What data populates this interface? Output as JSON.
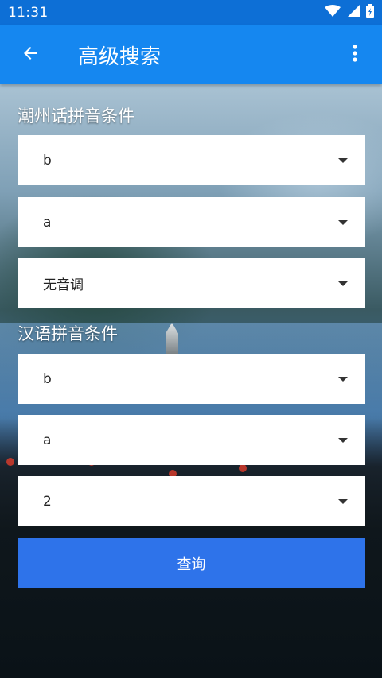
{
  "status_bar": {
    "time": "11:31",
    "icons": [
      "wifi-icon",
      "signal-icon",
      "battery-icon"
    ]
  },
  "app_bar": {
    "title": "高级搜索",
    "back_icon": "arrow-left-icon",
    "menu_icon": "more-vert-icon"
  },
  "chaozhou_section": {
    "label": "潮州话拼音条件",
    "initial": "b",
    "final": "a",
    "tone": "无音调"
  },
  "mandarin_section": {
    "label": "汉语拼音条件",
    "initial": "b",
    "final": "a",
    "tone": "2"
  },
  "query_button": {
    "label": "查询"
  },
  "colors": {
    "status_bar": "#0d6fd6",
    "app_bar": "#1587f0",
    "query_button": "#2e73ea"
  }
}
